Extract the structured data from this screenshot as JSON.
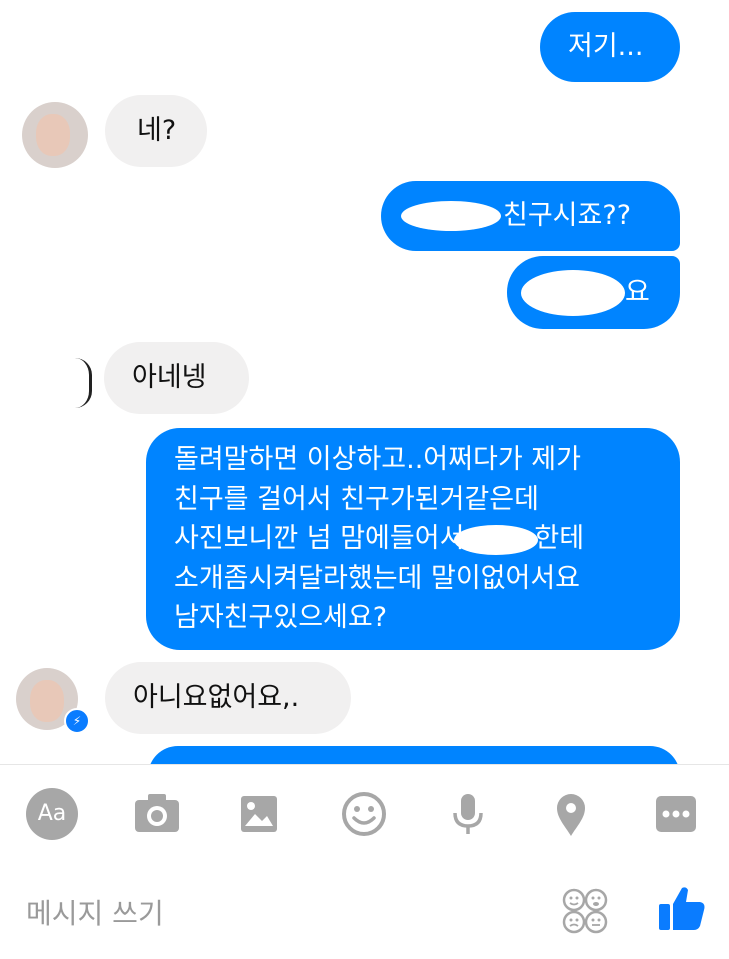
{
  "messages": [
    {
      "id": "m1",
      "direction": "outgoing",
      "text": "저기..."
    },
    {
      "id": "m2",
      "direction": "incoming",
      "text": "네?"
    },
    {
      "id": "m3",
      "direction": "outgoing",
      "text": "친구시죠??"
    },
    {
      "id": "m4",
      "direction": "outgoing",
      "text": "요"
    },
    {
      "id": "m5",
      "direction": "incoming",
      "text": "아네넹"
    },
    {
      "id": "m6",
      "direction": "outgoing",
      "lines": [
        "돌려말하면 이상하고..어쩌다가 제가",
        "친구를 걸어서 친구가된거같은데",
        "사진보니깐 넘 맘에들어서",
        "한테",
        "소개좀시켜달라했는데 말이없어서요",
        "남자친구있으세요?"
      ]
    },
    {
      "id": "m7",
      "direction": "incoming",
      "text": "아니요없어요,."
    }
  ],
  "composer": {
    "placeholder": "메시지 쓰기",
    "aa_label": "Aa",
    "icons": [
      "aa-icon",
      "camera-icon",
      "gallery-icon",
      "emoji-icon",
      "microphone-icon",
      "location-icon",
      "more-icon",
      "reactions-icon",
      "thumbs-up-icon"
    ]
  },
  "colors": {
    "outgoing": "#0084ff",
    "incoming": "#f1f0f0",
    "icon_gray": "#a7a7a7",
    "like_blue": "#0a7cff"
  }
}
